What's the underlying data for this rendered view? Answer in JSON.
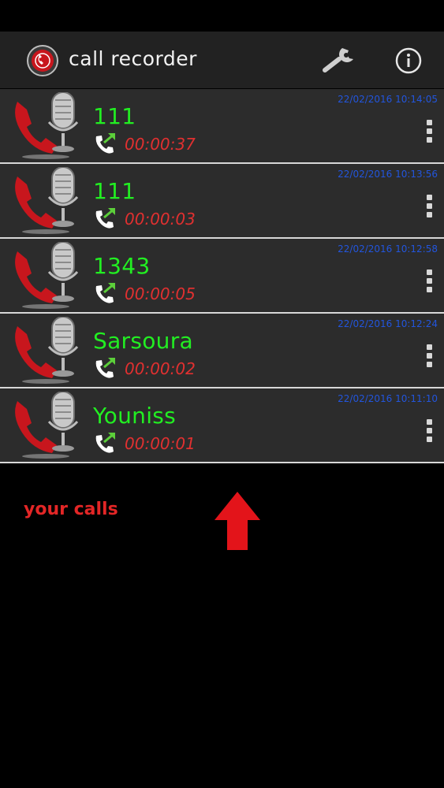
{
  "app": {
    "title": "call recorder",
    "logo_icon": "call-recorder-logo-icon",
    "settings_icon": "wrench-icon",
    "info_icon": "info-icon"
  },
  "calls": [
    {
      "name": "111",
      "duration": "00:00:37",
      "datetime": "22/02/2016 10:14:05",
      "direction_icon": "outgoing-call-icon"
    },
    {
      "name": "111",
      "duration": "00:00:03",
      "datetime": "22/02/2016 10:13:56",
      "direction_icon": "outgoing-call-icon"
    },
    {
      "name": "1343",
      "duration": "00:00:05",
      "datetime": "22/02/2016 10:12:58",
      "direction_icon": "outgoing-call-icon"
    },
    {
      "name": "Sarsoura",
      "duration": "00:00:02",
      "datetime": "22/02/2016 10:12:24",
      "direction_icon": "outgoing-call-icon"
    },
    {
      "name": "Youniss",
      "duration": "00:00:01",
      "datetime": "22/02/2016 10:11:10",
      "direction_icon": "outgoing-call-icon"
    }
  ],
  "hint": {
    "text": "your calls",
    "arrow_icon": "up-arrow-icon"
  },
  "colors": {
    "name": "#22ee22",
    "duration": "#e03030",
    "datetime": "#2255dd",
    "hint": "#e32626",
    "row_background": "#2c2c2c",
    "app_bar": "#222222"
  }
}
